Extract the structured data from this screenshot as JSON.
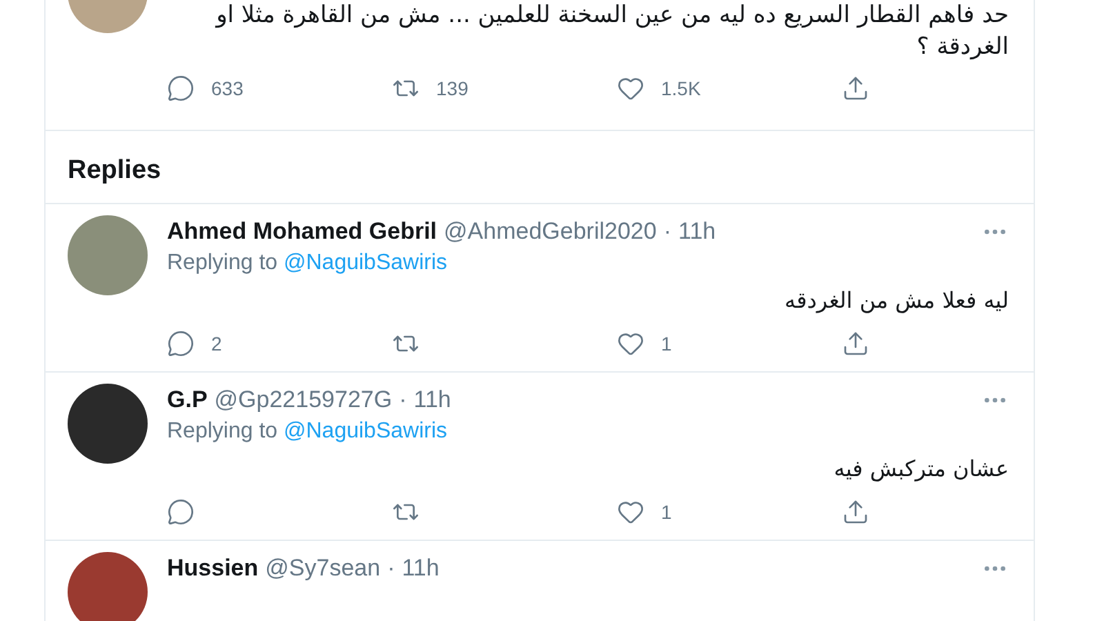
{
  "tweet": {
    "text": "حد فاهم القطار السريع ده ليه من عين السخنة للعلمين ... مش من القاهرة مثلا او الغردقة ؟",
    "actions": [
      {
        "kind": "reply",
        "count": "633"
      },
      {
        "kind": "retweet",
        "count": "139"
      },
      {
        "kind": "like",
        "count": "1.5K"
      },
      {
        "kind": "share"
      }
    ]
  },
  "replies_heading": "Replies",
  "replies": [
    {
      "name": "Ahmed Mohamed Gebril",
      "handle": "@AhmedGebril2020",
      "separator": "·",
      "time": "11h",
      "replying_label": "Replying to",
      "replying_to": "@NaguibSawiris",
      "text": "ليه فعلا مش من الغردقه",
      "actions": [
        {
          "kind": "reply",
          "count": "2"
        },
        {
          "kind": "retweet"
        },
        {
          "kind": "like",
          "count": "1"
        },
        {
          "kind": "share"
        }
      ]
    },
    {
      "name": "G.P",
      "handle": "@Gp22159727G",
      "separator": "·",
      "time": "11h",
      "replying_label": "Replying to",
      "replying_to": "@NaguibSawiris",
      "text": "عشان متركبش فيه",
      "actions": [
        {
          "kind": "reply"
        },
        {
          "kind": "retweet"
        },
        {
          "kind": "like",
          "count": "1"
        },
        {
          "kind": "share"
        }
      ]
    },
    {
      "name": "Hussien",
      "handle": "@Sy7sean",
      "separator": "·",
      "time": "11h"
    }
  ]
}
